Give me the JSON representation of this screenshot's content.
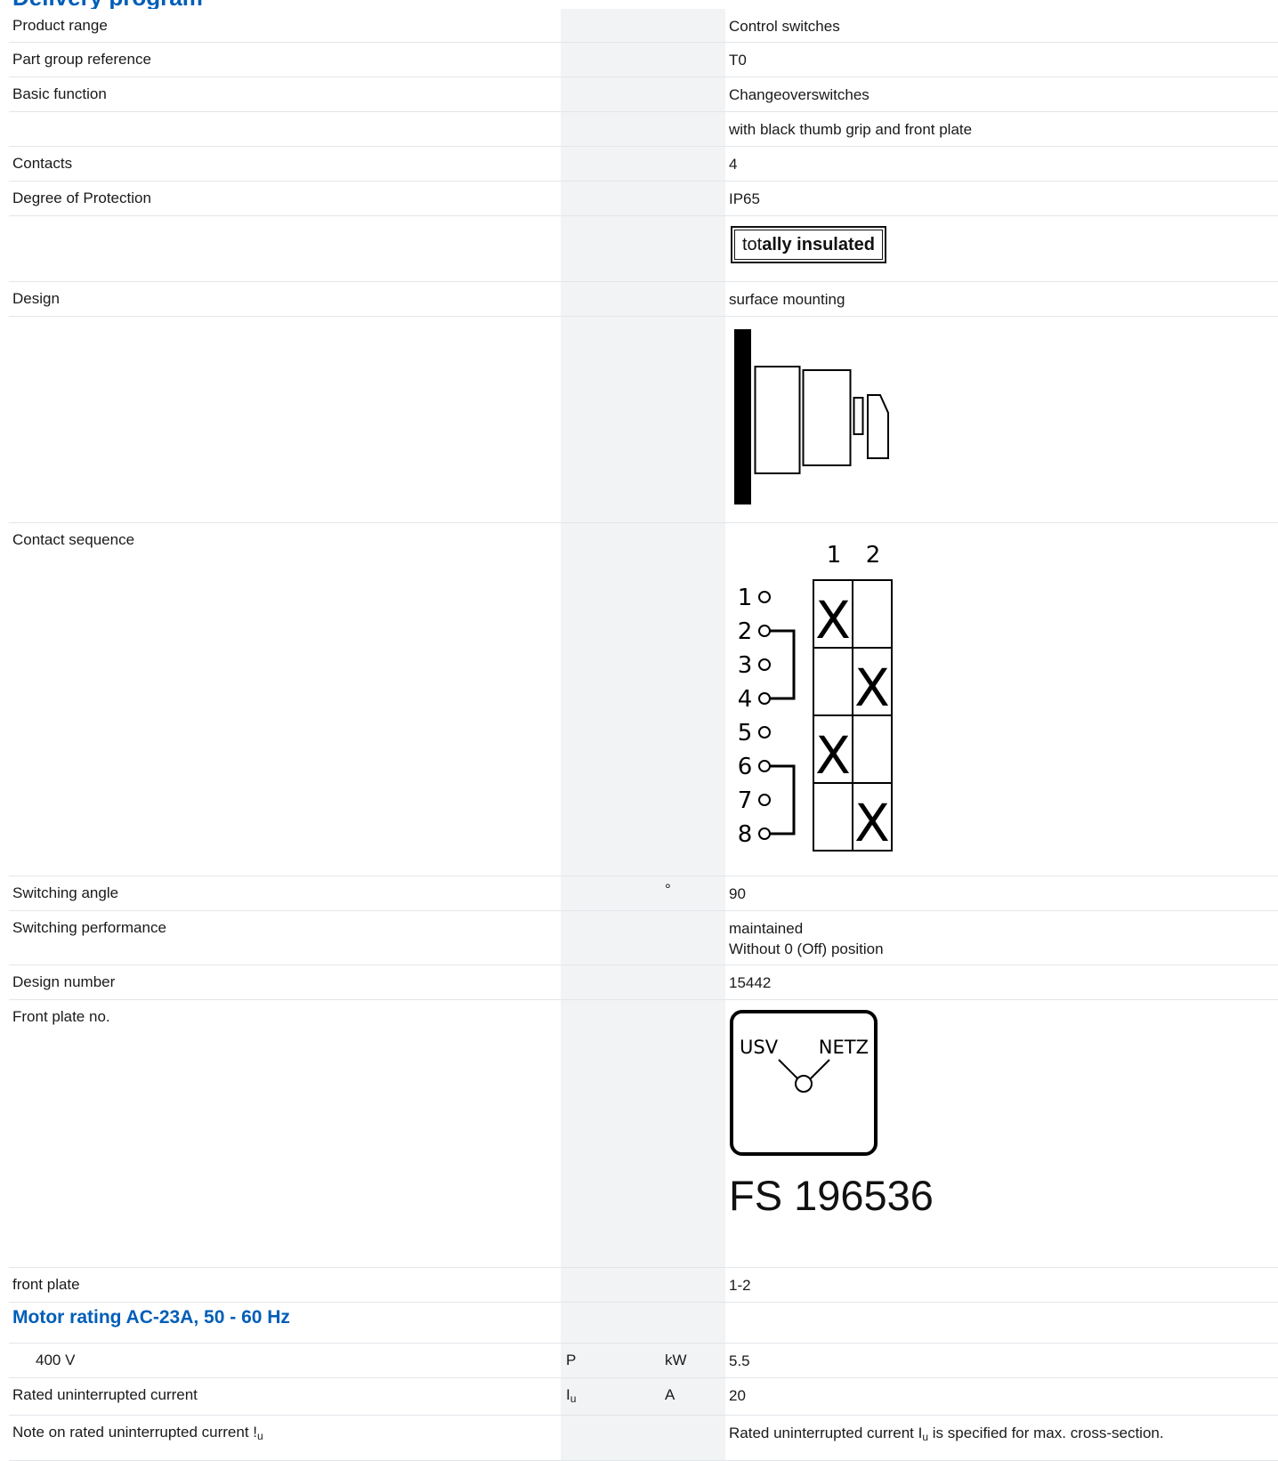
{
  "header": {
    "title_cut": "Delivery program"
  },
  "rows": {
    "product_range": {
      "label": "Product range",
      "value": "Control switches"
    },
    "part_group": {
      "label": "Part group reference",
      "value": "T0"
    },
    "basic_function": {
      "label": "Basic function",
      "value": "Changeoverswitches",
      "value2": "with black thumb grip and front plate"
    },
    "contacts": {
      "label": "Contacts",
      "value": "4"
    },
    "protection": {
      "label": "Degree of Protection",
      "value": "IP65",
      "badge_part1": "tot",
      "badge_part2": "ally ",
      "badge_part3": "insulated"
    },
    "design": {
      "label": "Design",
      "value": "surface mounting"
    },
    "contact_sequence": {
      "label": "Contact sequence",
      "positions": [
        "1",
        "2"
      ],
      "terminals": [
        "1",
        "2",
        "3",
        "4",
        "5",
        "6",
        "7",
        "8"
      ],
      "cross_mark": "X"
    },
    "switching_angle": {
      "label": "Switching angle",
      "unit": "°",
      "value": "90"
    },
    "switching_performance": {
      "label": "Switching performance",
      "value": "maintained",
      "value2": "Without 0 (Off) position"
    },
    "design_number": {
      "label": "Design number",
      "value": "15442"
    },
    "front_plate_no": {
      "label": "Front plate no.",
      "left_label": "USV",
      "right_label": "NETZ",
      "code": "FS 196536"
    },
    "front_plate": {
      "label": "front plate",
      "value": "1-2"
    }
  },
  "motor_section": {
    "title": "Motor rating AC-23A, 50 - 60 Hz"
  },
  "motor_rows": {
    "v400": {
      "label": "400 V",
      "symbol": "P",
      "unit": "kW",
      "value": "5.5"
    },
    "rated_current": {
      "label": "Rated uninterrupted current",
      "symbol": "I",
      "symbol_sub": "u",
      "unit": "A",
      "value": "20"
    },
    "note": {
      "label": "Note on rated uninterrupted current !",
      "label_sub": "u",
      "value_pre": "Rated uninterrupted current I",
      "value_sub": "u",
      "value_post": " is specified for max. cross-section."
    }
  }
}
